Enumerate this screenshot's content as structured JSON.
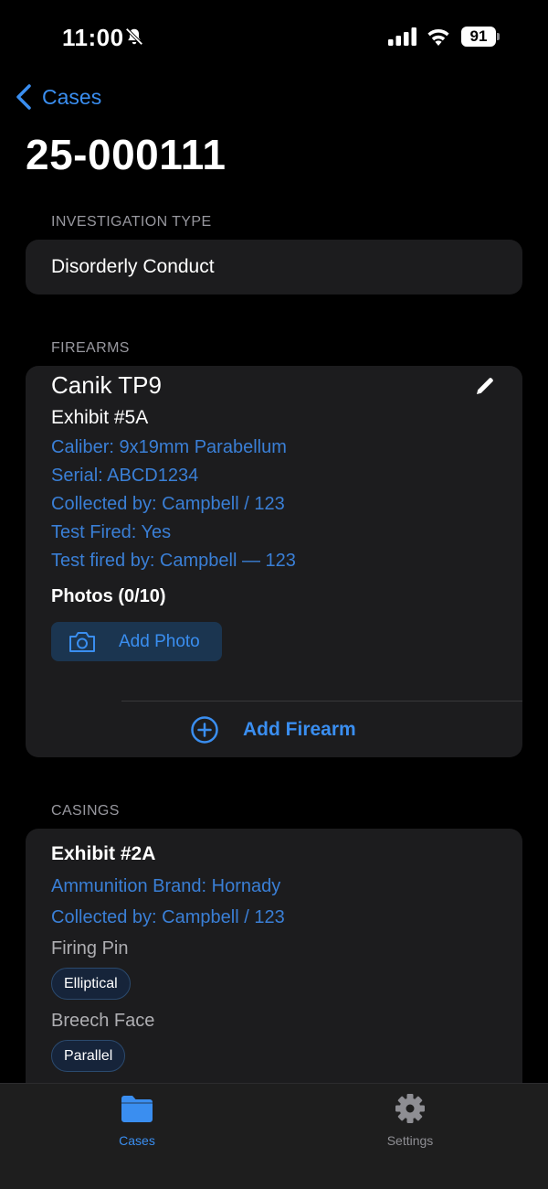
{
  "status_bar": {
    "time": "11:00",
    "battery": "91",
    "icons": [
      "bell-slash-icon",
      "cellular-signal-icon",
      "wifi-icon",
      "battery-icon"
    ]
  },
  "nav": {
    "back_label": "Cases",
    "back_icon": "chevron-left-icon",
    "title": "25-000111"
  },
  "investigation": {
    "header": "INVESTIGATION TYPE",
    "value": "Disorderly Conduct"
  },
  "firearms": {
    "header": "FIREARMS",
    "name": "Canik TP9",
    "edit_icon": "pencil-icon",
    "exhibit": "Exhibit #5A",
    "caliber": "Caliber: 9x19mm Parabellum",
    "serial": "Serial: ABCD1234",
    "collected_by": "Collected by: Campbell / 123",
    "test_fired": "Test Fired: Yes",
    "test_fired_by": "Test fired by: Campbell — 123",
    "photos_label": "Photos (0/10)",
    "add_photo_label": "Add Photo",
    "add_photo_icon": "camera-icon",
    "add_firearm_label": "Add Firearm",
    "add_firearm_icon": "plus-circle-icon"
  },
  "casings": {
    "header": "CASINGS",
    "exhibit": "Exhibit #2A",
    "ammo_brand": "Ammunition Brand: Hornady",
    "collected_by": "Collected by: Campbell / 123",
    "firing_pin_label": "Firing Pin",
    "firing_pin_value": "Elliptical",
    "breech_face_label": "Breech Face",
    "breech_face_value": "Parallel"
  },
  "tab_bar": {
    "tabs": [
      {
        "label": "Cases",
        "icon": "folder-icon",
        "selected": true
      },
      {
        "label": "Settings",
        "icon": "gear-icon",
        "selected": false
      }
    ]
  },
  "colors": {
    "accent": "#3a8ef0",
    "link_text": "#3a7fd6",
    "card_bg": "#1c1c1e",
    "background": "#000000"
  }
}
